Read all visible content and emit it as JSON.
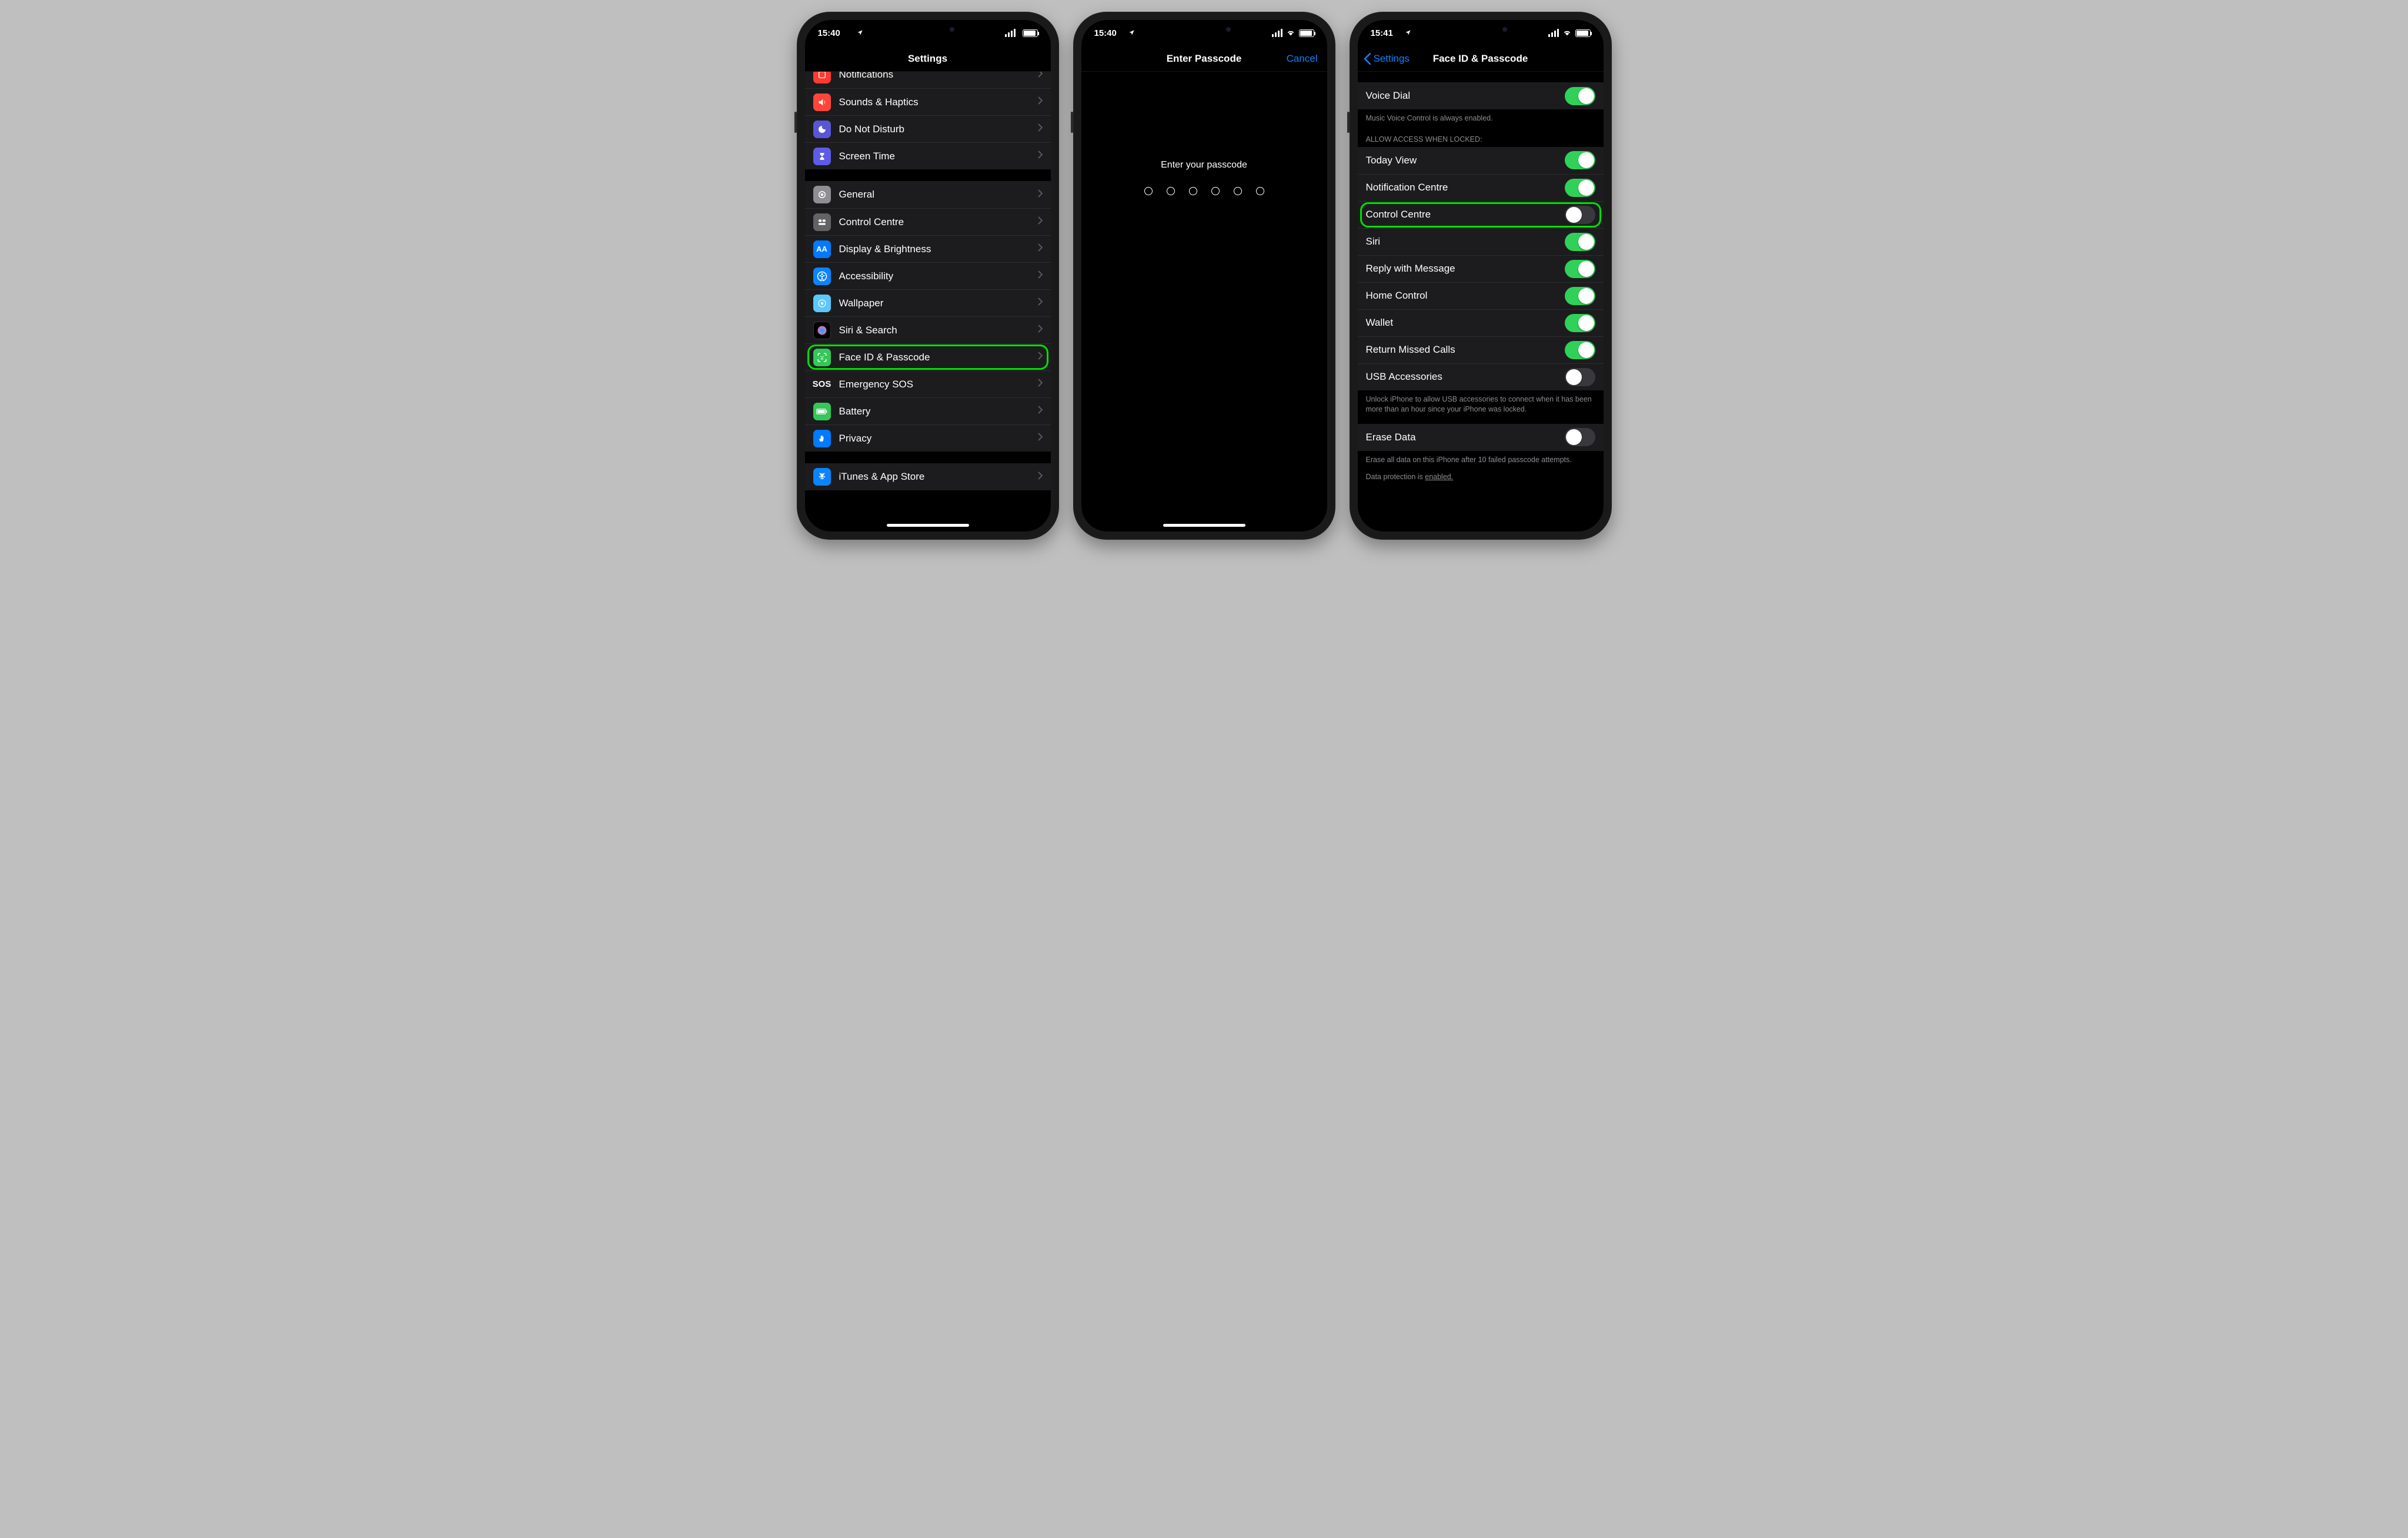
{
  "status": {
    "time1": "15:40",
    "time2": "15:40",
    "time3": "15:41"
  },
  "screen1": {
    "title": "Settings",
    "items_a": [
      {
        "label": "Notifications"
      },
      {
        "label": "Sounds & Haptics"
      },
      {
        "label": "Do Not Disturb"
      },
      {
        "label": "Screen Time"
      }
    ],
    "items_b": [
      {
        "label": "General"
      },
      {
        "label": "Control Centre"
      },
      {
        "label": "Display & Brightness"
      },
      {
        "label": "Accessibility"
      },
      {
        "label": "Wallpaper"
      },
      {
        "label": "Siri & Search"
      },
      {
        "label": "Face ID & Passcode"
      },
      {
        "label": "Emergency SOS"
      },
      {
        "label": "Battery"
      },
      {
        "label": "Privacy"
      }
    ],
    "items_c": [
      {
        "label": "iTunes & App Store"
      }
    ]
  },
  "screen2": {
    "title": "Enter Passcode",
    "cancel": "Cancel",
    "prompt": "Enter your passcode"
  },
  "screen3": {
    "back": "Settings",
    "title": "Face ID & Passcode",
    "voice_dial": {
      "label": "Voice Dial",
      "footer": "Music Voice Control is always enabled."
    },
    "section_header": "ALLOW ACCESS WHEN LOCKED:",
    "rows": [
      {
        "label": "Today View",
        "on": true
      },
      {
        "label": "Notification Centre",
        "on": true
      },
      {
        "label": "Control Centre",
        "on": false,
        "highlight": true
      },
      {
        "label": "Siri",
        "on": true
      },
      {
        "label": "Reply with Message",
        "on": true
      },
      {
        "label": "Home Control",
        "on": true
      },
      {
        "label": "Wallet",
        "on": true
      },
      {
        "label": "Return Missed Calls",
        "on": true
      },
      {
        "label": "USB Accessories",
        "on": false
      }
    ],
    "usb_footer": "Unlock iPhone to allow USB accessories to connect when it has been more than an hour since your iPhone was locked.",
    "erase": {
      "label": "Erase Data",
      "on": false
    },
    "erase_footer": "Erase all data on this iPhone after 10 failed passcode attempts.",
    "dp_prefix": "Data protection is ",
    "dp_link": "enabled."
  }
}
